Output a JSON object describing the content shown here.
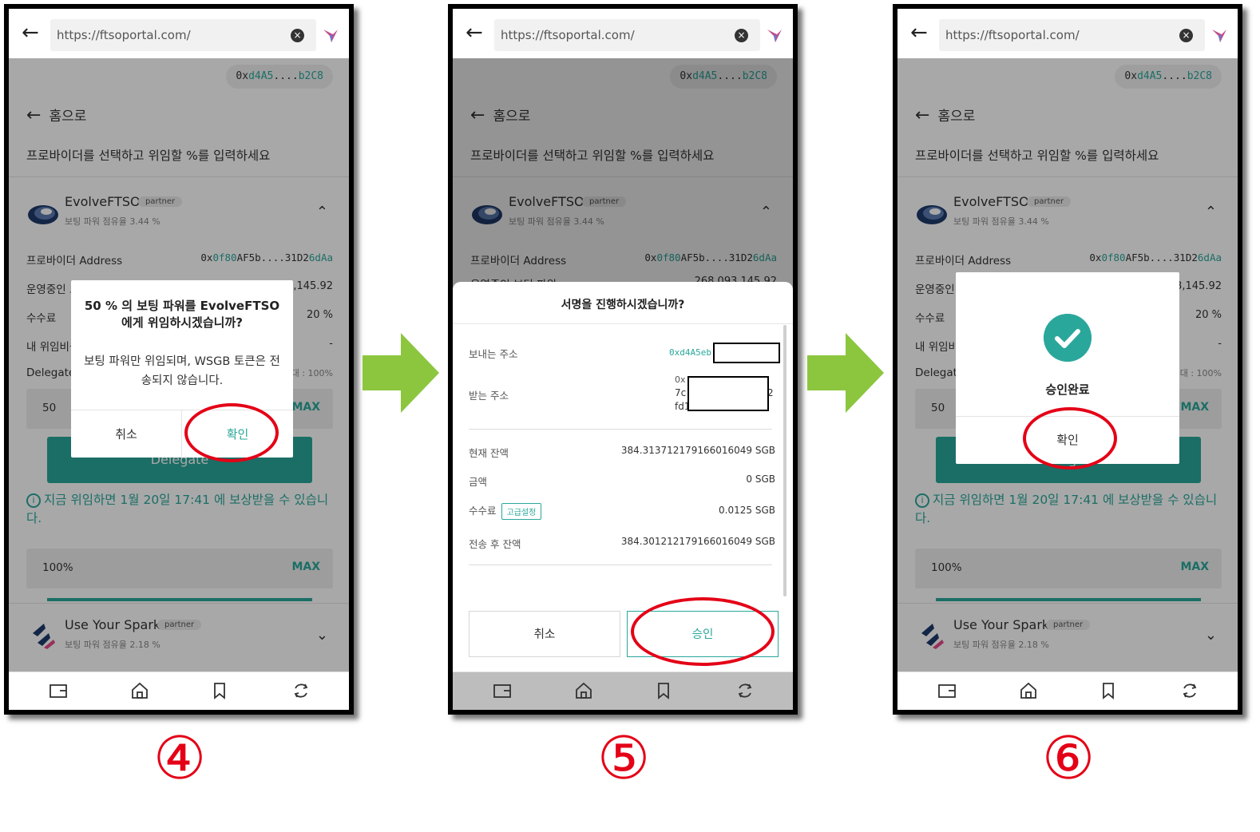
{
  "browser": {
    "url": "https://ftsoportal.com/"
  },
  "wallet_address": {
    "prefix": "0x",
    "highlight1": "d4A5",
    "dots": "....",
    "highlight2": "b2C8"
  },
  "page": {
    "home_link": "홈으로",
    "instruction": "프로바이더를 선택하고 위임할 %를 입력하세요",
    "partner_badge": "partner",
    "provider1": {
      "name": "EvolveFTSO",
      "vote_share": "보팅 파워 점유율 3.44 %"
    },
    "provider2": {
      "name": "Use Your Spark",
      "vote_share": "보팅 파워 점유율 2.18 %"
    },
    "rows": {
      "address_label": "프로바이더 Address",
      "address_prefix": "0x",
      "address_hl1": "0f80",
      "address_mid": "AF5b....31D2",
      "address_hl2": "6dAa",
      "operating_label": "운영중인 보팅 파워",
      "operating_value": "268,093,145.92",
      "fee_label": "수수료",
      "fee_value": "20 %",
      "my_label": "내 위임비율",
      "my_value": "-",
      "delegate_label": "Delegate",
      "delegate_max_label": "최대 : 100%"
    },
    "input1_value": "50",
    "input2_value": "100%",
    "max_label": "MAX",
    "delegate_button": "Delegate",
    "notice": "지금 위임하면 1월 20일 17:41 에 보상받을 수 있습니다.",
    "info_icon": "i"
  },
  "dialog_step4": {
    "title": "50 % 의 보팅 파워를 EvolveFTSO 에게 위임하시겠습니까?",
    "message": "보팅 파워만 위임되며, WSGB 토큰은 전송되지 않습니다.",
    "cancel": "취소",
    "confirm": "확인"
  },
  "sheet_step5": {
    "title": "서명을 진행하시겠습니까?",
    "from_label": "보내는 주소",
    "from_value": "0xd4A5eb",
    "to_label": "받는 주소",
    "to_line1": "0x",
    "to_line2": "7c",
    "to_line2_end": "2",
    "to_line3": "fd1",
    "balance_label": "현재 잔액",
    "balance_value": "384.313712179166016049 SGB",
    "amount_label": "금액",
    "amount_value": "0 SGB",
    "fee_label": "수수료",
    "advanced_badge": "고급설정",
    "fee_value": "0.0125 SGB",
    "after_label": "전송 후 잔액",
    "after_value": "384.301212179166016049 SGB",
    "cancel": "취소",
    "approve": "승인"
  },
  "dialog_step6": {
    "status": "승인완료",
    "confirm": "확인"
  },
  "step_numbers": [
    "④",
    "⑤",
    "⑥"
  ],
  "icons": {
    "back": "back-arrow-icon",
    "clear": "clear-circle-icon",
    "bird": "hummingbird-icon",
    "wallet": "wallet-icon",
    "home": "home-icon",
    "bookmark": "bookmark-icon",
    "refresh": "refresh-icon",
    "check": "check-icon",
    "next": "green-right-arrow-icon"
  },
  "colors": {
    "accent": "#2aa79b",
    "highlight_ring": "#e40016",
    "flow_arrow": "#8cc63f"
  }
}
